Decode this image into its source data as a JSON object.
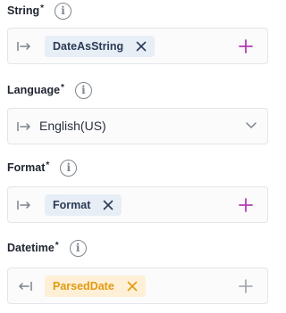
{
  "fields": {
    "string": {
      "label": "String",
      "required_mark": "*",
      "info": "i",
      "chip": "DateAsString"
    },
    "language": {
      "label": "Language",
      "required_mark": "*",
      "info": "i",
      "value": "English(US)"
    },
    "format": {
      "label": "Format",
      "required_mark": "*",
      "info": "i",
      "chip": "Format"
    },
    "datetime": {
      "label": "Datetime",
      "required_mark": "*",
      "info": "i",
      "chip": "ParsedDate"
    }
  },
  "colors": {
    "chip_blue_bg": "#e8eef6",
    "chip_orange_bg": "#fdf0d6",
    "chip_orange_text": "#e39a12",
    "plus_active": "#b23bb0",
    "plus_disabled": "#9aa0a8"
  },
  "icons": [
    "input-arrow-icon",
    "close-icon",
    "plus-icon",
    "info-icon",
    "chevron-down-icon"
  ]
}
